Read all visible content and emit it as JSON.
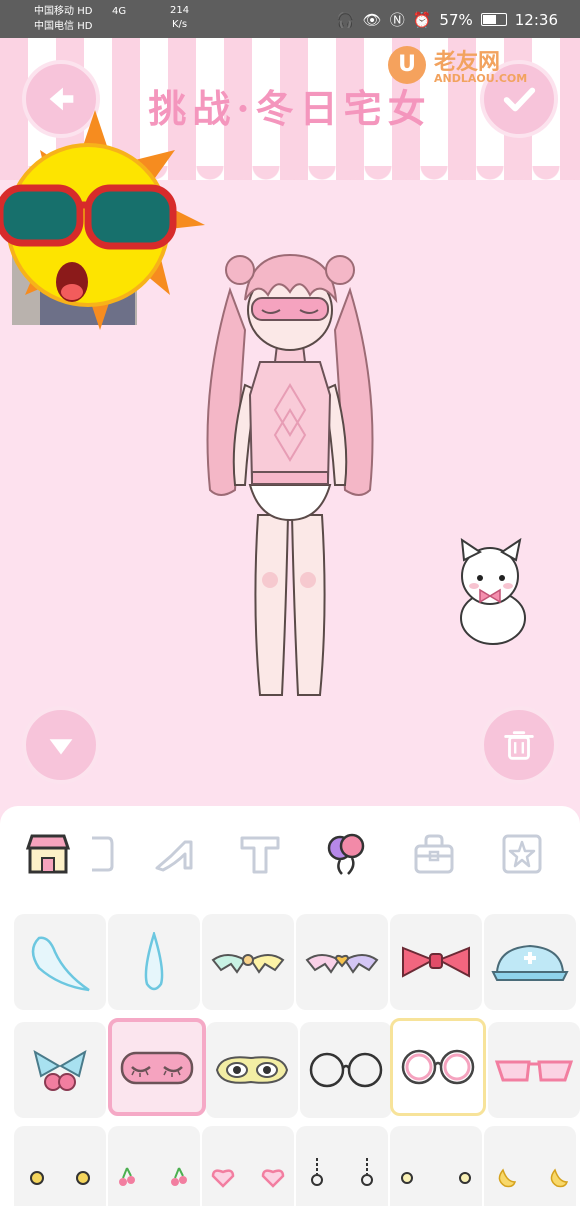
{
  "status_bar": {
    "carrier_1": "中国移动",
    "carrier_2": "中国电信",
    "hd_badge": "HD",
    "network": "4G",
    "speed_value": "214",
    "speed_unit": "K/s",
    "battery": "57%",
    "time": "12:36"
  },
  "header": {
    "title": "挑战·冬日宅女",
    "back_icon": "arrow-left-icon",
    "confirm_icon": "checkmark-icon"
  },
  "watermark": {
    "badge": "U",
    "text_cn": "老友网",
    "text_en": "ANDLAOU.COM"
  },
  "stage": {
    "collapse_icon": "triangle-down-icon",
    "trash_icon": "trash-icon",
    "character": "girl-with-pink-twintails-and-sleep-mask",
    "pet": "white-kitten-with-pink-bow",
    "sticker": "sun-with-sunglasses"
  },
  "category_tabs": [
    {
      "icon": "shop-icon",
      "active": true
    },
    {
      "icon": "shirt-icon",
      "active": false
    },
    {
      "icon": "heel-shoe-icon",
      "active": false
    },
    {
      "icon": "hat-letter-t-icon",
      "active": false
    },
    {
      "icon": "balloons-icon",
      "active": false
    },
    {
      "icon": "bag-icon",
      "active": false
    },
    {
      "icon": "star-frame-icon",
      "active": false
    }
  ],
  "items_grid": {
    "row_1": [
      "tear-drop-icon",
      "water-drop-icon",
      "pastel-ribbon-icon",
      "heart-ribbon-icon",
      "red-bow-icon",
      "nurse-cap-icon"
    ],
    "row_2": [
      "cherry-bow-icon",
      "sleep-mask-icon",
      "cartoon-eye-mask-icon",
      "round-glasses-black-icon",
      "round-glasses-pink-icon",
      "pink-sunglasses-icon"
    ],
    "row_3": [
      "yellow-dot-earrings-icon",
      "cherry-earrings-icon",
      "heart-earrings-icon",
      "drop-chain-earrings-icon",
      "gold-dot-earrings-icon",
      "moon-earrings-icon"
    ],
    "selected_item": "sleep-mask-icon",
    "equipped_item": "round-glasses-pink-icon"
  },
  "colors": {
    "background": "#fde1ee",
    "accent_pink": "#f496bd",
    "button_pink": "#f7c4da"
  }
}
